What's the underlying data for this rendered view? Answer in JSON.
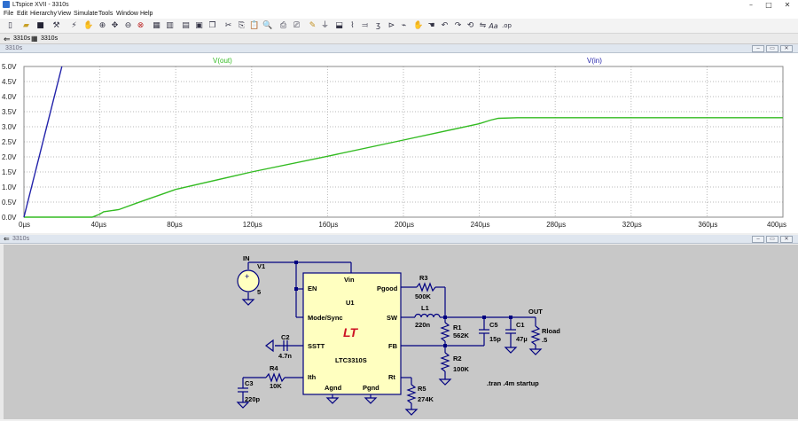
{
  "window": {
    "title": "LTspice XVII - 3310s",
    "minimize": "–",
    "maximize": "□",
    "close": "✕"
  },
  "menu": [
    "File",
    "Edit",
    "Hierarchy",
    "View",
    "Simulate",
    "Tools",
    "Window",
    "Help"
  ],
  "tabs": [
    {
      "label": "3310s",
      "icon": "waveform-icon"
    },
    {
      "label": "3310s",
      "icon": "schematic-icon"
    }
  ],
  "plot_pane": {
    "title": "3310s"
  },
  "schematic_pane": {
    "title": "3310s"
  },
  "chart_data": {
    "type": "line",
    "xlabel": "",
    "ylabel": "",
    "xlim": [
      0,
      400
    ],
    "ylim": [
      0,
      5.0
    ],
    "x_ticks": [
      "0µs",
      "40µs",
      "80µs",
      "120µs",
      "160µs",
      "200µs",
      "240µs",
      "280µs",
      "320µs",
      "360µs",
      "400µs"
    ],
    "y_ticks": [
      "0.0V",
      "0.5V",
      "1.0V",
      "1.5V",
      "2.0V",
      "2.5V",
      "3.0V",
      "3.5V",
      "4.0V",
      "4.5V",
      "5.0V"
    ],
    "grid": true,
    "series": [
      {
        "name": "V(out)",
        "color": "#33bb22",
        "x": [
          0,
          36,
          40,
          42,
          50,
          60,
          80,
          120,
          160,
          200,
          240,
          246,
          250,
          260,
          300,
          400
        ],
        "y": [
          0,
          0,
          0.1,
          0.18,
          0.25,
          0.48,
          0.92,
          1.5,
          2.02,
          2.56,
          3.1,
          3.22,
          3.28,
          3.3,
          3.3,
          3.3
        ]
      },
      {
        "name": "V(in)",
        "color": "#2222aa",
        "x": [
          0,
          20
        ],
        "y": [
          0,
          5.0
        ]
      }
    ]
  },
  "schematic": {
    "ic_name": "U1",
    "ic_part": "LTC3310S",
    "pins_left": [
      "EN",
      "Mode/Sync",
      "SSTT",
      "Ith"
    ],
    "pins_right": [
      "Pgood",
      "SW",
      "FB",
      "Rt"
    ],
    "pins_top": [
      "Vin"
    ],
    "pins_bottom": [
      "Agnd",
      "Pgnd"
    ],
    "source": {
      "name": "V1",
      "value": "5",
      "net": "IN"
    },
    "out_net": "OUT",
    "components": [
      {
        "name": "R3",
        "value": "500K"
      },
      {
        "name": "L1",
        "value": "220n"
      },
      {
        "name": "R1",
        "value": "562K"
      },
      {
        "name": "R2",
        "value": "100K"
      },
      {
        "name": "C5",
        "value": "15p"
      },
      {
        "name": "C1",
        "value": "47µ"
      },
      {
        "name": "Rload",
        "value": ".5"
      },
      {
        "name": "C2",
        "value": "4.7n"
      },
      {
        "name": "R4",
        "value": "10K"
      },
      {
        "name": "C3",
        "value": "220p"
      },
      {
        "name": "R5",
        "value": "274K"
      }
    ],
    "directive": ".tran .4m startup"
  }
}
